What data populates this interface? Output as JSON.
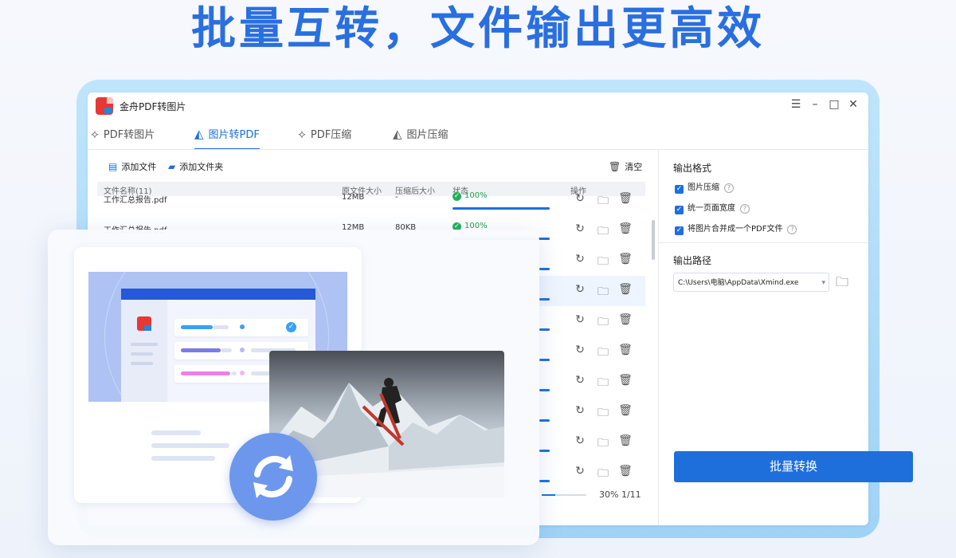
{
  "headline": "批量互转，文件输出更高效",
  "window": {
    "title": "金舟PDF转图片",
    "controls": [
      "☰",
      "–",
      "□",
      "✕"
    ]
  },
  "tabs": [
    {
      "label": "PDF转图片",
      "icon": "pdf-icon",
      "active": false
    },
    {
      "label": "图片转PDF",
      "icon": "image-to-pdf-icon",
      "active": true
    },
    {
      "label": "PDF压缩",
      "icon": "pdf-compress-icon",
      "active": false
    },
    {
      "label": "图片压缩",
      "icon": "image-compress-icon",
      "active": false
    }
  ],
  "toolbar": {
    "add_file": "添加文件",
    "add_folder": "添加文件夹",
    "clear": "清空"
  },
  "table": {
    "columns": [
      "文件名称(11)",
      "原文件大小",
      "压缩后大小",
      "状态",
      "操作"
    ],
    "rows": [
      {
        "name": "工作汇总报告.pdf",
        "orig": "12MB",
        "comp": "-",
        "status": "100%"
      },
      {
        "name": "工作汇总报告.pdf",
        "orig": "12MB",
        "comp": "80KB",
        "status": "100%"
      }
    ]
  },
  "right_panel": {
    "format_title": "输出格式",
    "options": [
      {
        "label": "图片压缩",
        "checked": true
      },
      {
        "label": "统一页面宽度",
        "checked": true
      },
      {
        "label": "将图片合并成一个PDF文件",
        "checked": true
      }
    ],
    "path_title": "输出路径",
    "path_value": "C:\\Users\\电脑\\AppData\\Xmind.exe"
  },
  "convert_button": "批量转换",
  "progress": {
    "value": 0.3,
    "text": "30% 1/11"
  },
  "colors": {
    "accent": "#1e6fdc",
    "success": "#22b05a",
    "headline": "#2a6fe0"
  }
}
